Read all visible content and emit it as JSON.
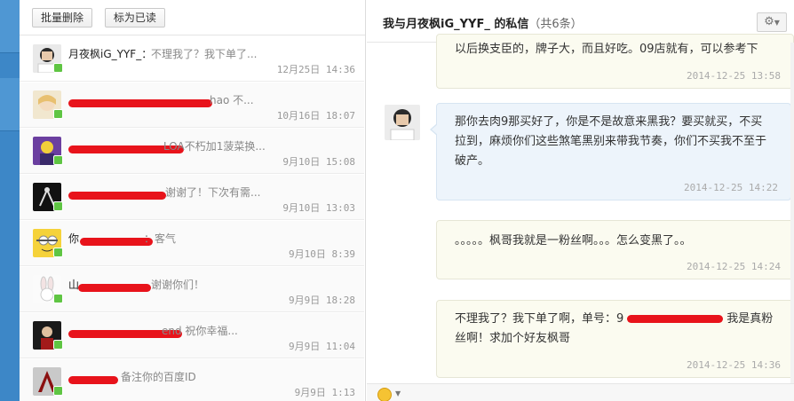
{
  "toolbar": {
    "batch_delete": "批量删除",
    "mark_read": "标为已读"
  },
  "conversations": [
    {
      "name": "月夜枫iG_YYF_：",
      "preview": "不理我了？我下单了...",
      "time": "12月25日 14:36"
    },
    {
      "name": "",
      "preview": "hao 不...",
      "time": "10月16日 18:07"
    },
    {
      "name": "",
      "preview": "LOA不朽加1菠菜换...",
      "time": "9月10日 15:08"
    },
    {
      "name": "",
      "preview": "谢谢了！下次有需...",
      "time": "9月10日 13:03"
    },
    {
      "name": "你",
      "preview": "：客气",
      "time": "9月10日 8:39"
    },
    {
      "name": "山",
      "preview": "谢谢你们！",
      "time": "9月9日 18:28"
    },
    {
      "name": "",
      "preview": "end 祝你幸福...",
      "time": "9月9日 11:04"
    },
    {
      "name": "",
      "preview": "备注你的百度ID",
      "time": "9月9日 1:13"
    }
  ],
  "chat": {
    "title": "我与月夜枫iG_YYF_ 的私信",
    "count": "（共6条）",
    "messages": [
      {
        "side": "me",
        "text": "以后换支臣的，牌子大，而且好吃。09店就有，可以参考下",
        "time": "2014-12-25 13:58"
      },
      {
        "side": "peer",
        "text": "那你去肉9那买好了，你是不是故意来黑我？要买就买，不买拉到，麻烦你们这些煞笔黑别来带我节奏，你们不买我不至于破产。",
        "time": "2014-12-25 14:22"
      },
      {
        "side": "me",
        "text": "。。。。。枫哥我就是一粉丝啊。。。怎么变黑了。。",
        "time": "2014-12-25 14:24"
      },
      {
        "side": "me",
        "text_a": "不理我了？我下单了啊，单号：9",
        "text_b": "我是真粉丝啊！求加个好友枫哥",
        "time": "2014-12-25 14:36"
      }
    ]
  },
  "icons": {
    "settings": "gear-icon",
    "emoji": "smile-icon"
  },
  "colors": {
    "accent": "#3d87c7",
    "online": "#5fc543",
    "redaction": "#e8131b"
  }
}
